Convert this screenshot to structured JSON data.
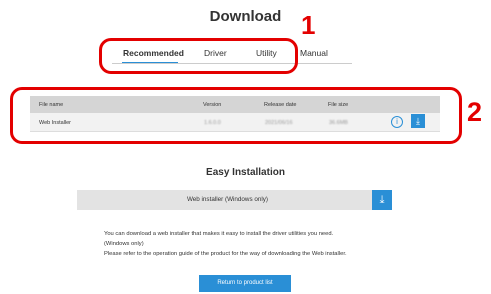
{
  "page": {
    "title": "Download"
  },
  "annotations": {
    "marker_tabs": "1",
    "marker_table": "2",
    "color": "#e30000"
  },
  "tabs": [
    {
      "label": "Recommended",
      "active": true
    },
    {
      "label": "Driver",
      "active": false
    },
    {
      "label": "Utility",
      "active": false
    },
    {
      "label": "Manual",
      "active": false
    }
  ],
  "table": {
    "headers": {
      "file_name": "File name",
      "version": "Version",
      "release_date": "Release date",
      "file_size": "File size"
    },
    "rows": [
      {
        "file_name": "Web Installer",
        "version": "1.6.0.0",
        "release_date": "2021/06/16",
        "file_size": "36.6MB",
        "info_icon": "info-icon",
        "download_icon": "download-icon"
      }
    ]
  },
  "easy_installation": {
    "title": "Easy Installation",
    "installer_label": "Web installer (Windows only)",
    "download_icon": "download-icon",
    "description_lines": [
      "You can download a web installer that makes it easy to install the driver utilities you need.",
      "(Windows only)",
      "Please refer to the operation guide of the product for the way of downloading the Web installer."
    ]
  },
  "return_button": {
    "label": "Return to product list"
  },
  "colors": {
    "accent": "#2a8fd6",
    "table_header": "#d5d5d5",
    "installer_bar": "#e3e3e3"
  }
}
